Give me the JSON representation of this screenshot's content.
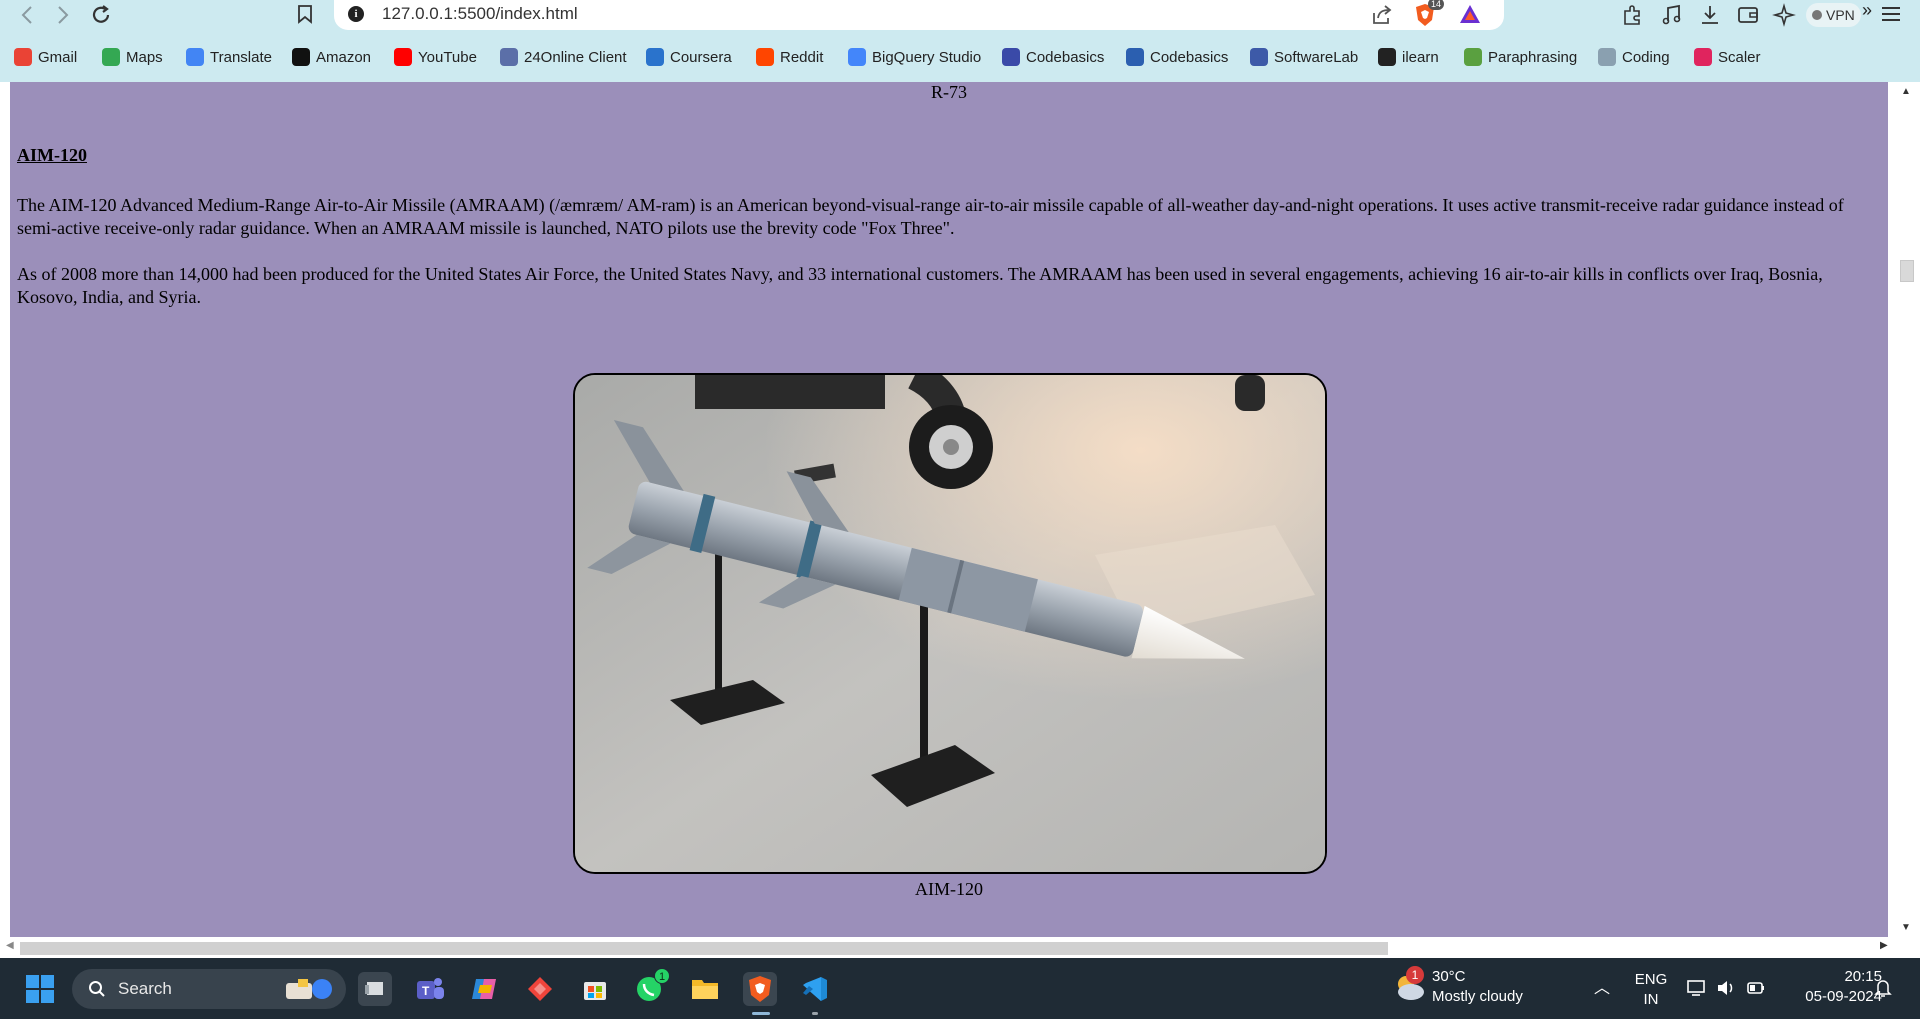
{
  "browser": {
    "url": "127.0.0.1:5500/index.html",
    "shield_count": "14",
    "vpn_label": "VPN",
    "bookmarks": [
      {
        "label": "Gmail",
        "icon": "gmail-icon",
        "color": "#ea4335"
      },
      {
        "label": "Maps",
        "icon": "maps-icon",
        "color": "#34a853"
      },
      {
        "label": "Translate",
        "icon": "translate-icon",
        "color": "#4285f4"
      },
      {
        "label": "Amazon",
        "icon": "amazon-icon",
        "color": "#111111"
      },
      {
        "label": "YouTube",
        "icon": "youtube-icon",
        "color": "#ff0000"
      },
      {
        "label": "24Online Client",
        "icon": "online-client-icon",
        "color": "#5b6fa8"
      },
      {
        "label": "Coursera",
        "icon": "coursera-icon",
        "color": "#2a73cc"
      },
      {
        "label": "Reddit",
        "icon": "reddit-icon",
        "color": "#ff4500"
      },
      {
        "label": "BigQuery Studio",
        "icon": "bigquery-icon",
        "color": "#4386fa"
      },
      {
        "label": "Codebasics",
        "icon": "rocket-icon",
        "color": "#3a4aa8"
      },
      {
        "label": "Codebasics",
        "icon": "codebasics-icon",
        "color": "#2b5fb0"
      },
      {
        "label": "SoftwareLab",
        "icon": "softwarelab-icon",
        "color": "#3d5aa8"
      },
      {
        "label": "ilearn",
        "icon": "ilearn-icon",
        "color": "#222222"
      },
      {
        "label": "Paraphrasing",
        "icon": "paraphrasing-icon",
        "color": "#5aa040"
      },
      {
        "label": "Coding",
        "icon": "coding-icon",
        "color": "#8aa0b0"
      },
      {
        "label": "Scaler",
        "icon": "scaler-icon",
        "color": "#e0245e"
      }
    ]
  },
  "page": {
    "prev_caption": "R-73",
    "heading": "AIM-120",
    "paragraphs": [
      "The AIM-120 Advanced Medium-Range Air-to-Air Missile (AMRAAM) (/æmræm/ AM-ram) is an American beyond-visual-range air-to-air missile capable of all-weather day-and-night operations. It uses active transmit-receive radar guidance instead of semi-active receive-only radar guidance. When an AMRAAM missile is launched, NATO pilots use the brevity code \"Fox Three\".",
      "As of 2008 more than 14,000 had been produced for the United States Air Force, the United States Navy, and 33 international customers. The AMRAAM has been used in several engagements, achieving 16 air-to-air kills in conflicts over Iraq, Bosnia, Kosovo, India, and Syria."
    ],
    "figure_caption": "AIM-120",
    "background_color": "#9b8fba"
  },
  "taskbar": {
    "search_label": "Search",
    "weather_badge": "1",
    "weather_temp": "30°C",
    "weather_desc": "Mostly cloudy",
    "lang_line1": "ENG",
    "lang_line2": "IN",
    "time": "20:15",
    "date": "05-09-2024",
    "whatsapp_badge": "1"
  }
}
